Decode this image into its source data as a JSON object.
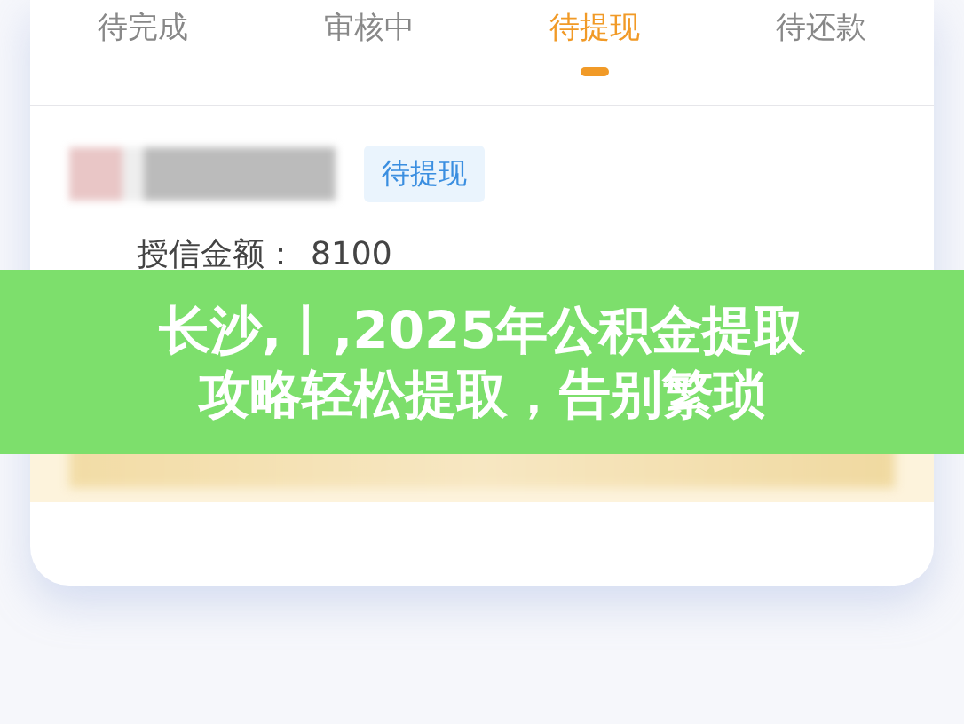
{
  "tabs": [
    {
      "label": "待完成",
      "selected": false
    },
    {
      "label": "审核中",
      "selected": false
    },
    {
      "label": "待提现",
      "selected": true
    },
    {
      "label": "待还款",
      "selected": false
    }
  ],
  "record": {
    "status_badge": "待提现",
    "credit_label": "授信金额：",
    "credit_amount": "8100"
  },
  "overlay_title": [
    "长沙,丨,2025年公积金提取",
    "攻略轻松提取，告别繁琐"
  ]
}
